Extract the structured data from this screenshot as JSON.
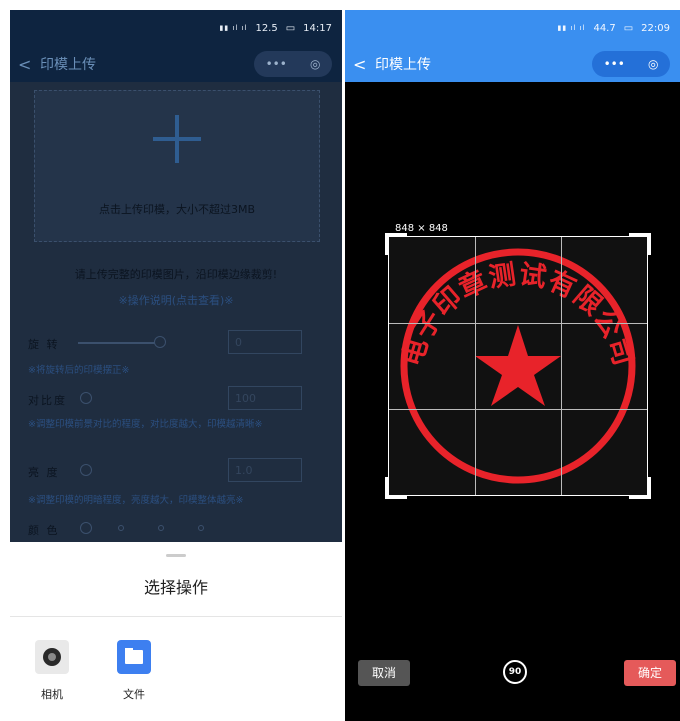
{
  "left_screen": {
    "status": {
      "net": "4G",
      "speed": "12.5",
      "time": "14:17"
    },
    "nav": {
      "back": "<",
      "title": "印模上传"
    },
    "upload": {
      "hint": "点击上传印模，大小不超过3MB"
    },
    "notice": "请上传完整的印模图片，沿印模边缘裁剪!",
    "guide_link": "※操作说明(点击查看)※",
    "controls": [
      {
        "label": "旋  转",
        "value": "0"
      },
      {
        "label": "对比度",
        "value": "100"
      },
      {
        "label": "亮  度",
        "value": "1.0"
      },
      {
        "label": "颜  色",
        "value": ""
      }
    ],
    "hints": [
      "※将旋转后的印模摆正※",
      "※调整印模前景对比的程度，对比度越大，印模越清晰※",
      "※调整印模的明暗程度，亮度越大，印模整体越亮※"
    ],
    "sheet": {
      "title": "选择操作",
      "options": [
        {
          "label": "相机",
          "icon": "camera-icon"
        },
        {
          "label": "文件",
          "icon": "folder-icon"
        }
      ]
    }
  },
  "right_screen": {
    "status": {
      "net": "4G",
      "speed": "44.7",
      "time": "22:09"
    },
    "nav": {
      "back": "<",
      "title": "印模上传"
    },
    "crop_size": "848 × 848",
    "stamp": {
      "company": "电子印章测试有限公司",
      "color": "#e8232a"
    },
    "buttons": {
      "cancel": "取消",
      "rotate": "90",
      "confirm": "确定"
    }
  },
  "colors": {
    "accent_blue": "#3a8ff0",
    "confirm_red": "#e55a5a",
    "overlay": "#1f2d40"
  }
}
